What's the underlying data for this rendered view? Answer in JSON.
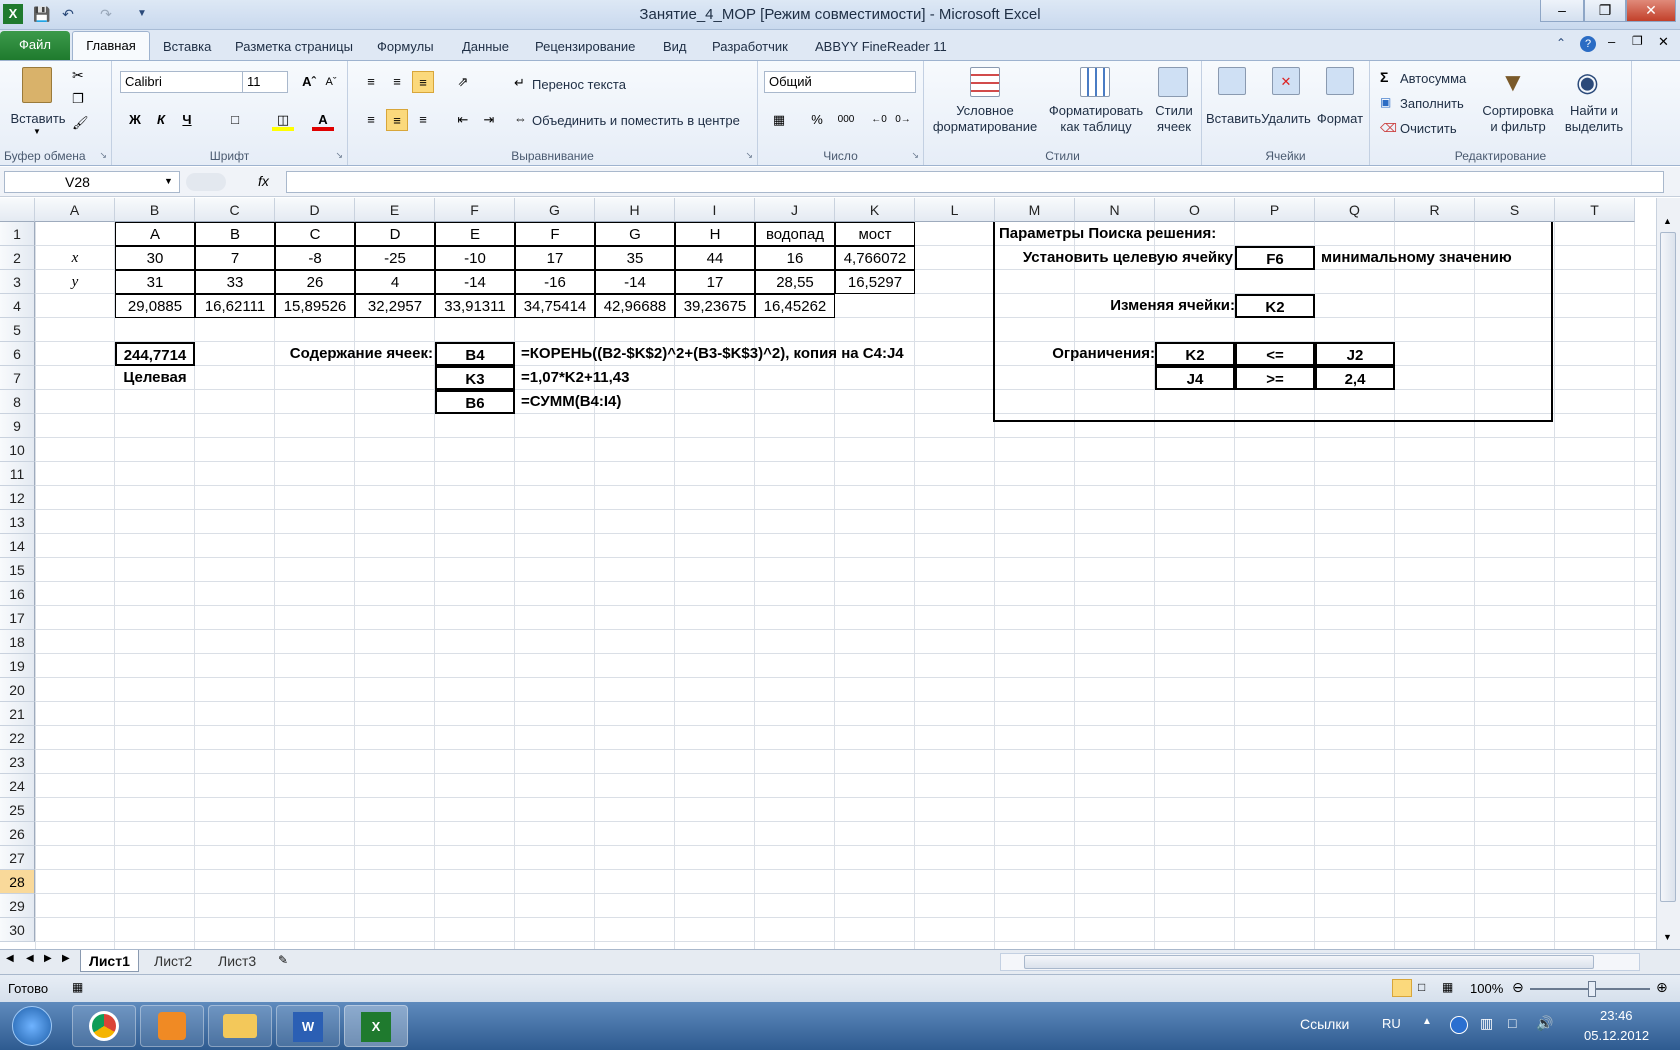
{
  "window": {
    "title": "Занятие_4_МОР  [Режим совместимости]  -  Microsoft Excel"
  },
  "quick_access": {
    "save_icon": "save-icon",
    "undo_icon": "undo-icon",
    "redo_icon": "redo-icon"
  },
  "tabs": {
    "file": "Файл",
    "home": "Главная",
    "insert": "Вставка",
    "layout": "Разметка страницы",
    "formulas": "Формулы",
    "data": "Данные",
    "review": "Рецензирование",
    "view": "Вид",
    "developer": "Разработчик",
    "abbyy": "ABBYY FineReader 11"
  },
  "ribbon": {
    "clipboard": {
      "paste": "Вставить",
      "label": "Буфер обмена"
    },
    "font": {
      "name": "Calibri",
      "size": "11",
      "bold": "Ж",
      "italic": "К",
      "underline": "Ч",
      "label": "Шрифт"
    },
    "alignment": {
      "wrap": "Перенос текста",
      "merge": "Объединить и поместить в центре",
      "label": "Выравнивание"
    },
    "number": {
      "format": "Общий",
      "percent": "%",
      "thousands": "000",
      "label": "Число"
    },
    "styles": {
      "conditional1": "Условное",
      "conditional2": "форматирование",
      "table1": "Форматировать",
      "table2": "как таблицу",
      "cell1": "Стили",
      "cell2": "ячеек",
      "label": "Стили"
    },
    "cells": {
      "insert": "Вставить",
      "delete": "Удалить",
      "format": "Формат",
      "label": "Ячейки"
    },
    "editing": {
      "autosum": "Автосумма",
      "fill": "Заполнить",
      "clear": "Очистить",
      "sort1": "Сортировка",
      "sort2": "и фильтр",
      "find1": "Найти и",
      "find2": "выделить",
      "label": "Редактирование"
    }
  },
  "formula_bar": {
    "name_box": "V28",
    "fx": "fx",
    "formula": ""
  },
  "columns": [
    "A",
    "B",
    "C",
    "D",
    "E",
    "F",
    "G",
    "H",
    "I",
    "J",
    "K",
    "L",
    "M",
    "N",
    "O",
    "P",
    "Q",
    "R",
    "S",
    "T"
  ],
  "rows": [
    "1",
    "2",
    "3",
    "4",
    "5",
    "6",
    "7",
    "8",
    "9",
    "10",
    "11",
    "12",
    "13",
    "14",
    "15",
    "16",
    "17",
    "18",
    "19",
    "20",
    "21",
    "22",
    "23",
    "24",
    "25",
    "26",
    "27",
    "28",
    "29",
    "30"
  ],
  "table": {
    "headers": [
      "A",
      "B",
      "C",
      "D",
      "E",
      "F",
      "G",
      "H",
      "водопад",
      "мост"
    ],
    "x_label": "x",
    "y_label": "y",
    "x": [
      "30",
      "7",
      "-8",
      "-25",
      "-10",
      "17",
      "35",
      "44",
      "16",
      "4,766072"
    ],
    "y": [
      "31",
      "33",
      "26",
      "4",
      "-14",
      "-16",
      "-14",
      "17",
      "28,55",
      "16,5297"
    ],
    "dist": [
      "29,0885",
      "16,62111",
      "15,89526",
      "32,2957",
      "33,91311",
      "34,75414",
      "42,96688",
      "39,23675",
      "16,45262"
    ]
  },
  "target": {
    "value": "244,7714",
    "label": "Целевая"
  },
  "contents": {
    "label": "Содержание ячеек:",
    "cells": [
      "B4",
      "K3",
      "B6"
    ],
    "formulas": [
      "=КОРЕНЬ((B2-$K$2)^2+(B3-$K$3)^2), копия на C4:J4",
      "=1,07*K2+11,43",
      "=СУММ(B4:I4)"
    ]
  },
  "solver": {
    "title": "Параметры Поиска решения:",
    "target_label": "Установить целевую ячейку",
    "target_cell": "F6",
    "goal": "минимальному значению",
    "changing_label": "Изменяя ячейки:",
    "changing_cell": "K2",
    "constraints_label": "Ограничения:",
    "constraints": [
      [
        "K2",
        "<=",
        "J2"
      ],
      [
        "J4",
        ">=",
        "2,4"
      ]
    ]
  },
  "sheets": [
    "Лист1",
    "Лист2",
    "Лист3"
  ],
  "status": {
    "ready": "Готово",
    "zoom": "100%"
  },
  "taskbar": {
    "links": "Ссылки",
    "lang": "RU",
    "time": "23:46",
    "date": "05.12.2012"
  }
}
